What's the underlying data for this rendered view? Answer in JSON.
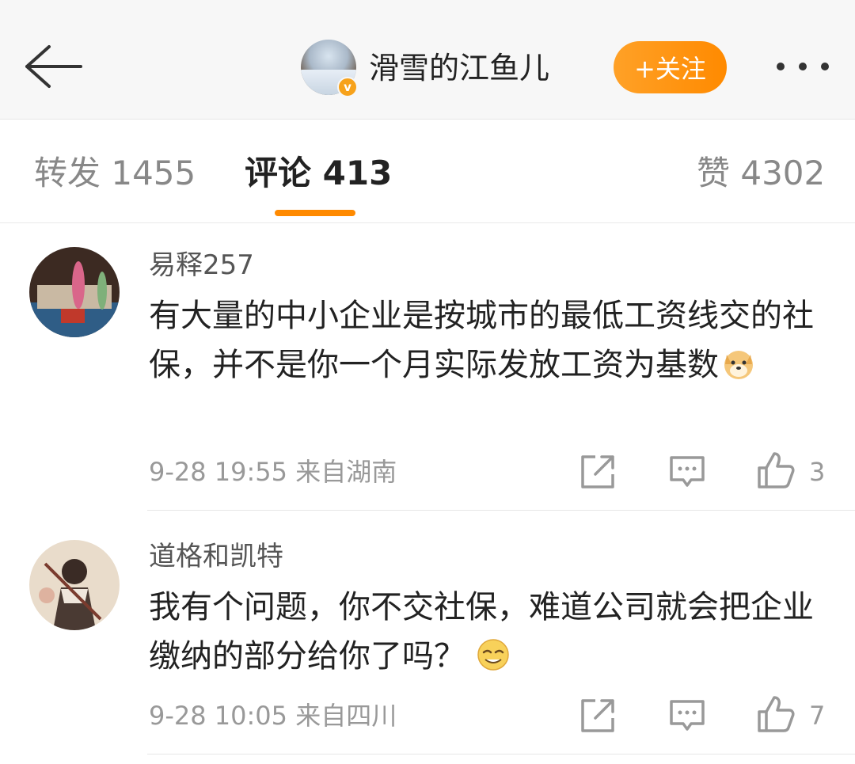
{
  "header": {
    "username": "滑雪的江鱼儿",
    "verified_mark": "v",
    "follow_label": "+关注"
  },
  "tabs": [
    {
      "label": "转发 1455"
    },
    {
      "label": "评论 413"
    },
    {
      "label": "赞 4302"
    }
  ],
  "comments": [
    {
      "user": "易释257",
      "text": "有大量的中小企业是按城市的最低工资线交的社保，并不是你一个月实际发放工资为基数",
      "emoji": "doge-emoji",
      "date": "9-28 19:55",
      "location": "来自湖南",
      "likes": "3"
    },
    {
      "user": "道格和凯特",
      "text": "我有个问题，你不交社保，难道公司就会把企业缴纳的部分给你了吗？",
      "emoji": "smirk-emoji",
      "date": "9-28 10:05",
      "location": "来自四川",
      "likes": "7"
    }
  ],
  "icons": {
    "back": "back-arrow-icon",
    "more": "more-dots-icon",
    "repost": "repost-icon",
    "comment": "comment-icon",
    "like": "thumbs-up-icon"
  },
  "colors": {
    "accent": "#ff8a00",
    "verified": "#f7a21b",
    "header_bg": "#f7f7f7"
  }
}
